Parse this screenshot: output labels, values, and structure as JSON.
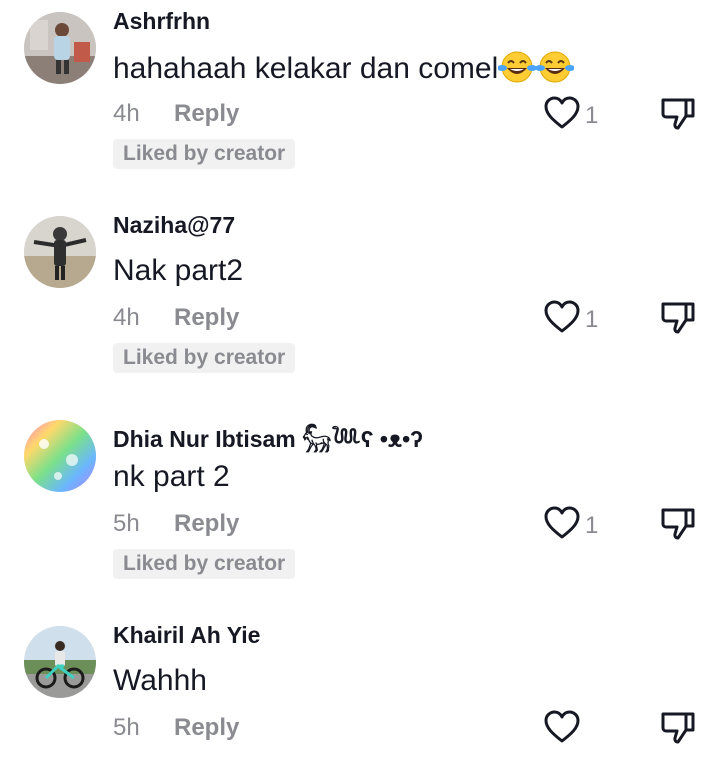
{
  "comments": [
    {
      "username": "Ashrfrhn",
      "text": "hahahaah kelakar dan comel",
      "emojis": [
        "face-with-tears-of-joy",
        "face-with-tears-of-joy"
      ],
      "time": "4h",
      "reply_label": "Reply",
      "like_count": "1",
      "badge": "Liked by creator"
    },
    {
      "username": "Naziha@77",
      "text": "Nak part2",
      "time": "4h",
      "reply_label": "Reply",
      "like_count": "1",
      "badge": "Liked by creator"
    },
    {
      "username": "Dhia Nur Ibtisam 𓃵𓆙ʕ •ᴥ•ʔ",
      "text": "nk part 2",
      "time": "5h",
      "reply_label": "Reply",
      "like_count": "1",
      "badge": "Liked by creator"
    },
    {
      "username": "Khairil Ah Yie",
      "text": "Wahhh",
      "time": "5h",
      "reply_label": "Reply",
      "like_count": ""
    }
  ],
  "icons": {
    "like": "heart-outline-icon",
    "dislike": "thumbs-down-icon"
  },
  "colors": {
    "primary_text": "#161823",
    "secondary_text": "#8a8b91",
    "badge_bg": "#f1f1f2"
  }
}
